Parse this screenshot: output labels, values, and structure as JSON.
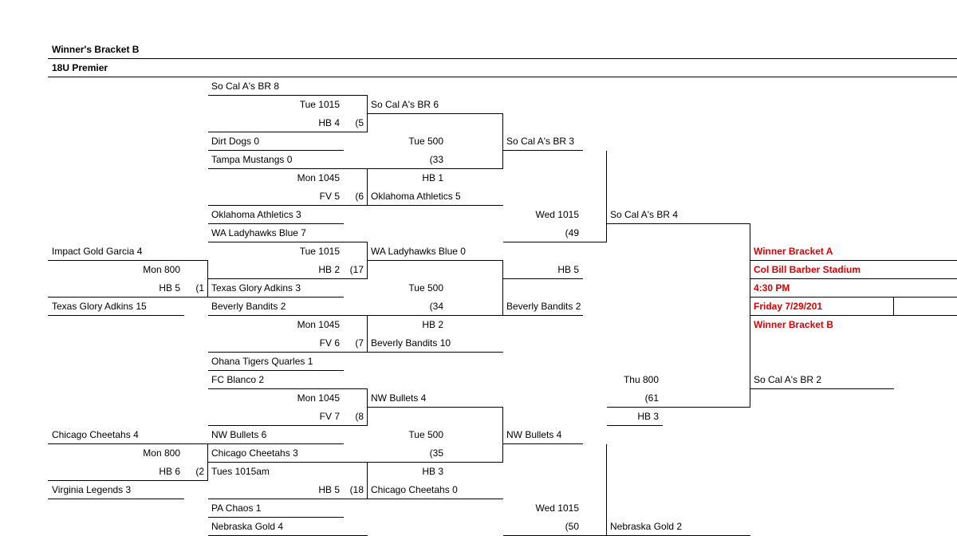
{
  "header": {
    "title": "Winner's Bracket B",
    "sub": "18U Premier"
  },
  "r1": {
    "t1": "So Cal A's BR   8"
  },
  "r2": {
    "t1": "Tue 1015",
    "t2": "So Cal A's BR  6"
  },
  "r3": {
    "t1": "HB 4",
    "n1": "(5"
  },
  "r4": {
    "t1": "Dirt Dogs   0",
    "t2": "Tue 500",
    "t3": "So Cal A's BR 3"
  },
  "r5": {
    "t1": "Tampa Mustangs 0",
    "n1": "(33"
  },
  "r6": {
    "t1": "Mon 1045",
    "t2": "HB 1"
  },
  "r7": {
    "t1": "FV 5",
    "n1": "(6",
    "t2": "Oklahoma Athletics  5"
  },
  "r8": {
    "t1": "Oklahoma Athletics   3",
    "t2": "Wed 1015",
    "t3": "So Cal A's BR 4"
  },
  "r9": {
    "t1": "WA Ladyhawks Blue   7",
    "n1": "(49"
  },
  "r10": {
    "t0": "Impact Gold Garcia   4",
    "t1": "Tue 1015",
    "t2": "WA Ladyhawks Blue   0",
    "red": "Winner Bracket A"
  },
  "r11": {
    "t0": "Mon 800",
    "t1": "HB 2",
    "n1": "(17",
    "t2": "HB 5",
    "red": "Col Bill Barber Stadium"
  },
  "r12": {
    "t0": "HB 5",
    "n0": "(1",
    "t1": "Texas Glory Adkins   3",
    "t2": "Tue 500",
    "red": "4:30 PM"
  },
  "r13": {
    "t0": "Texas Glory Adkins   15",
    "t1": "Beverly Bandits  2",
    "n1": "(34",
    "t2": "Beverly Bandits 2",
    "red": "Friday 7/29/201"
  },
  "r14": {
    "t1": "Mon 1045",
    "t2": "HB 2",
    "red": "Winner Bracket B"
  },
  "r15": {
    "t1": "FV 6",
    "n1": "(7",
    "t2": "Beverly Bandits 10"
  },
  "r16": {
    "t1": "Ohana Tigers Quarles   1"
  },
  "r17": {
    "t1": "FC Blanco  2",
    "t2": "Thu 800",
    "t3": "So Cal A's BR 2"
  },
  "r18": {
    "t1": "Mon 1045",
    "t2": "NW Bullets  4",
    "n1": "(61"
  },
  "r19": {
    "t1": "FV 7",
    "n1": "(8",
    "t2": "HB 3"
  },
  "r20": {
    "t0": "Chicago Cheetahs   4",
    "t1": "NW Bullets   6",
    "t2": "Tue 500",
    "t3": "NW Bullets 4"
  },
  "r21": {
    "t0": "Mon 800",
    "t1": "Chicago Cheetahs   3",
    "n1": "(35"
  },
  "r22": {
    "t0": "HB 6",
    "n0": "(2",
    "t1": "Tues 1015am",
    "t2": "HB 3"
  },
  "r23": {
    "t0": "Virginia Legends   3",
    "t1": "HB 5",
    "n1": "(18",
    "t2": "Chicago Cheetahs  0"
  },
  "r24": {
    "t1": "PA Chaos   1",
    "t2": "Wed 1015"
  },
  "r25": {
    "t1": "Nebraska Gold   4",
    "n1": "(50",
    "t2": "Nebraska Gold 2"
  }
}
